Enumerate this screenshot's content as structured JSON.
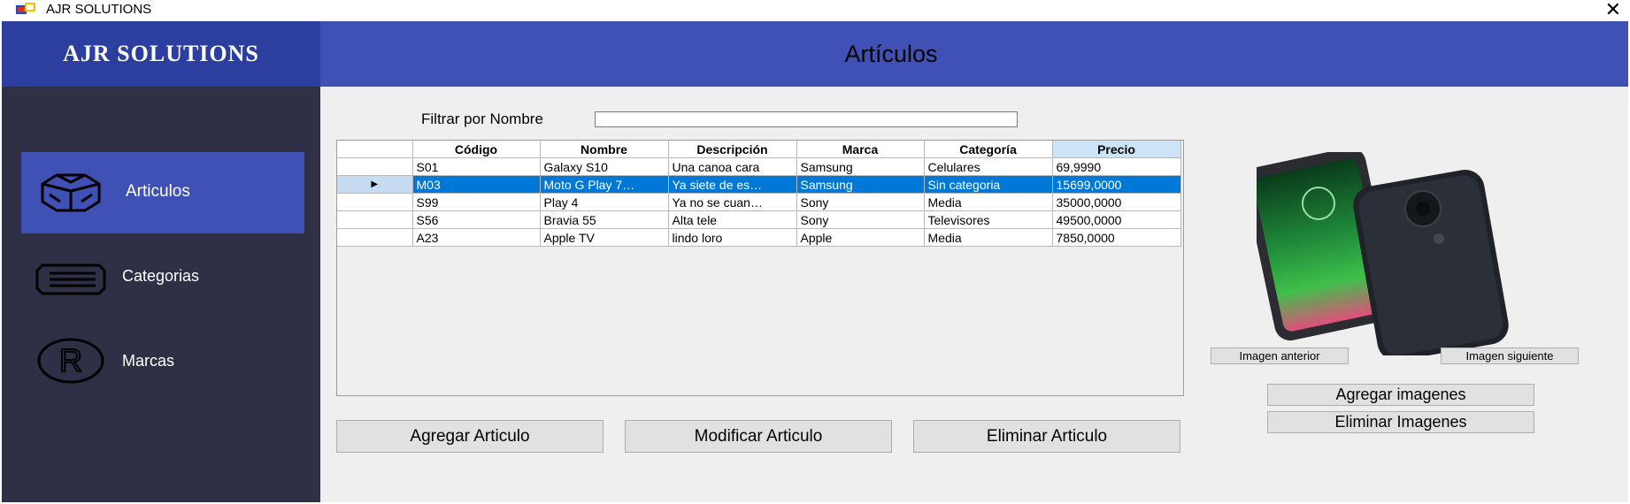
{
  "window": {
    "title": "AJR SOLUTIONS"
  },
  "sidebar": {
    "brand": "AJR SOLUTIONS",
    "items": [
      {
        "label": "Articulos",
        "icon": "box-icon",
        "active": true
      },
      {
        "label": "Categorias",
        "icon": "tag-icon",
        "active": false
      },
      {
        "label": "Marcas",
        "icon": "registered-icon",
        "active": false
      }
    ]
  },
  "header": {
    "title": "Artículos"
  },
  "filter": {
    "label": "Filtrar por Nombre",
    "value": ""
  },
  "grid": {
    "columns": [
      "Código",
      "Nombre",
      "Descripción",
      "Marca",
      "Categoría",
      "Precio"
    ],
    "sorted_column": "Precio",
    "rows": [
      [
        "S01",
        "Galaxy S10",
        "Una canoa cara",
        "Samsung",
        "Celulares",
        "69,9990"
      ],
      [
        "M03",
        "Moto G Play 7…",
        "Ya siete de es…",
        "Samsung",
        "Sin categoria",
        "15699,0000"
      ],
      [
        "S99",
        "Play 4",
        "Ya no se cuan…",
        "Sony",
        "Media",
        "35000,0000"
      ],
      [
        "S56",
        "Bravia 55",
        "Alta tele",
        "Sony",
        "Televisores",
        "49500,0000"
      ],
      [
        "A23",
        "Apple TV",
        "lindo loro",
        "Apple",
        "Media",
        "7850,0000"
      ]
    ],
    "selected_row": 1,
    "row_indicator": "▶"
  },
  "buttons": {
    "add": "Agregar Articulo",
    "modify": "Modificar Articulo",
    "delete": "Eliminar Articulo",
    "prev_image": "Imagen anterior",
    "next_image": "Imagen siguiente",
    "add_images": "Agregar imagenes",
    "delete_images": "Eliminar Imagenes"
  },
  "colors": {
    "header": "#3f51b5",
    "brand": "#2d3f9e",
    "sidebar": "#2f2f46",
    "selection": "#0078d7"
  }
}
